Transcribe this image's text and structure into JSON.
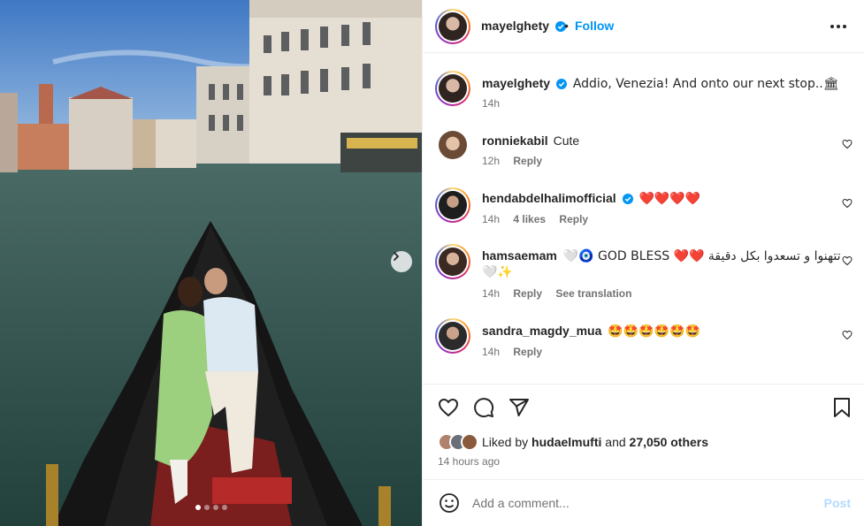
{
  "post": {
    "author": "mayelghety",
    "follow_label": "Follow",
    "caption": "Addio, Venezia! And onto our next stop..🏛",
    "caption_time": "14h",
    "carousel": {
      "slides": 4,
      "active_index": 0
    }
  },
  "comments": [
    {
      "username": "ronniekabil",
      "verified": false,
      "text": "Cute",
      "time": "12h",
      "likes": "",
      "reply_label": "Reply",
      "extra": ""
    },
    {
      "username": "hendabdelhalimofficial",
      "verified": true,
      "text": "❤️❤️❤️❤️",
      "time": "14h",
      "likes": "4 likes",
      "reply_label": "Reply",
      "extra": ""
    },
    {
      "username": "hamsaemam",
      "verified": false,
      "text": "🤍🧿 GOD BLESS ❤️❤️ تتهنوا و تسعدوا بكل دقيقة",
      "text2": "🤍✨",
      "time": "14h",
      "likes": "",
      "reply_label": "Reply",
      "extra": "See translation"
    },
    {
      "username": "sandra_magdy_mua",
      "verified": false,
      "text": "🤩🤩🤩🤩🤩🤩",
      "time": "14h",
      "likes": "",
      "reply_label": "Reply",
      "extra": ""
    }
  ],
  "engagement": {
    "liked_by_prefix": "Liked by",
    "liked_by_user": "hudaelmufti",
    "and_label": "and",
    "others_count": "27,050 others",
    "posted_ago": "14 hours ago"
  },
  "composer": {
    "placeholder": "Add a comment...",
    "post_label": "Post"
  },
  "icons": {
    "verified": "verified-badge-icon",
    "more": "more-options-icon",
    "like": "heart-icon",
    "comment": "comment-icon",
    "share": "share-icon",
    "save": "bookmark-icon",
    "emoji": "emoji-icon",
    "next": "chevron-right-icon"
  },
  "colors": {
    "link": "#0095f6",
    "verified": "#0095f6",
    "post_disabled": "#b3dbff",
    "muted": "#737373"
  }
}
